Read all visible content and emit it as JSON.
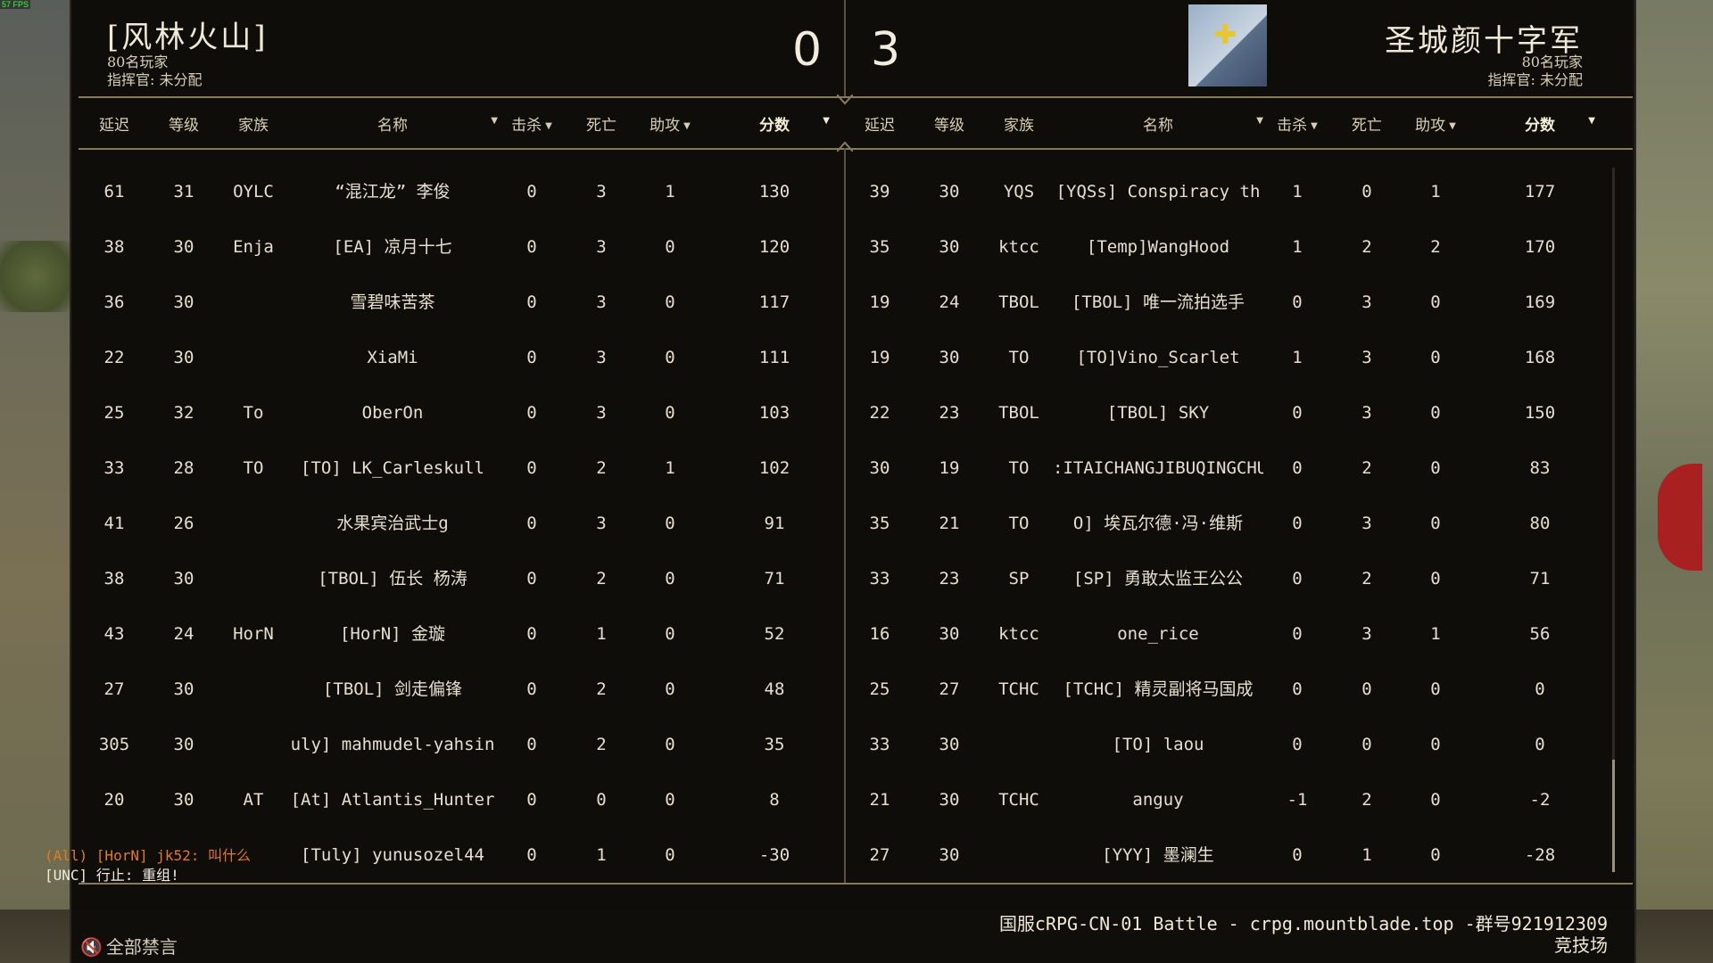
{
  "fps": "57 FPS",
  "left_team": {
    "name": "[风林火山]",
    "players": "80名玩家",
    "commander": "指挥官: 未分配",
    "score": "0"
  },
  "right_team": {
    "name": "圣城颜十字军",
    "players": "80名玩家",
    "commander": "指挥官: 未分配",
    "score": "3",
    "banner_icon": "cross-icon",
    "banner_colors": [
      "#c8d4e0",
      "#3e4e6a",
      "#e8c72a"
    ]
  },
  "columns": {
    "ping": "延迟",
    "level": "等级",
    "clan": "家族",
    "name": "名称",
    "kills": "击杀",
    "deaths": "死亡",
    "assists": "助攻",
    "score": "分数"
  },
  "left_rows": [
    {
      "ping": "61",
      "level": "31",
      "clan": "OYLC",
      "name": "“混江龙” 李俊",
      "kills": "0",
      "deaths": "3",
      "assists": "1",
      "score": "130"
    },
    {
      "ping": "38",
      "level": "30",
      "clan": "Enja",
      "name": "[EA] 凉月十七",
      "kills": "0",
      "deaths": "3",
      "assists": "0",
      "score": "120"
    },
    {
      "ping": "36",
      "level": "30",
      "clan": "",
      "name": "雪碧味苦茶",
      "kills": "0",
      "deaths": "3",
      "assists": "0",
      "score": "117"
    },
    {
      "ping": "22",
      "level": "30",
      "clan": "",
      "name": "XiaMi",
      "kills": "0",
      "deaths": "3",
      "assists": "0",
      "score": "111"
    },
    {
      "ping": "25",
      "level": "32",
      "clan": "To",
      "name": "OberOn",
      "kills": "0",
      "deaths": "3",
      "assists": "0",
      "score": "103"
    },
    {
      "ping": "33",
      "level": "28",
      "clan": "TO",
      "name": "[TO] LK_Carleskull",
      "kills": "0",
      "deaths": "2",
      "assists": "1",
      "score": "102"
    },
    {
      "ping": "41",
      "level": "26",
      "clan": "",
      "name": "水果宾治武士g",
      "kills": "0",
      "deaths": "3",
      "assists": "0",
      "score": "91"
    },
    {
      "ping": "38",
      "level": "30",
      "clan": "",
      "name": "[TBOL] 伍长 杨涛",
      "kills": "0",
      "deaths": "2",
      "assists": "0",
      "score": "71"
    },
    {
      "ping": "43",
      "level": "24",
      "clan": "HorN",
      "name": "[HorN] 金璇",
      "kills": "0",
      "deaths": "1",
      "assists": "0",
      "score": "52"
    },
    {
      "ping": "27",
      "level": "30",
      "clan": "",
      "name": "[TBOL] 剑走偏锋",
      "kills": "0",
      "deaths": "2",
      "assists": "0",
      "score": "48"
    },
    {
      "ping": "305",
      "level": "30",
      "clan": "",
      "name": "uly] mahmudel-yahsin",
      "kills": "0",
      "deaths": "2",
      "assists": "0",
      "score": "35"
    },
    {
      "ping": "20",
      "level": "30",
      "clan": "AT",
      "name": "[At] Atlantis_Hunter",
      "kills": "0",
      "deaths": "0",
      "assists": "0",
      "score": "8"
    },
    {
      "ping": "",
      "level": "",
      "clan": "",
      "name": "[Tuly] yunusozel44",
      "kills": "0",
      "deaths": "1",
      "assists": "0",
      "score": "-30"
    }
  ],
  "right_rows": [
    {
      "ping": "39",
      "level": "30",
      "clan": "YQS",
      "name": "[YQSs] Conspiracy th",
      "kills": "1",
      "deaths": "0",
      "assists": "1",
      "score": "177"
    },
    {
      "ping": "35",
      "level": "30",
      "clan": "ktcc",
      "name": "[Temp]WangHood",
      "kills": "1",
      "deaths": "2",
      "assists": "2",
      "score": "170"
    },
    {
      "ping": "19",
      "level": "24",
      "clan": "TBOL",
      "name": "[TBOL] 唯一流拍选手",
      "kills": "0",
      "deaths": "3",
      "assists": "0",
      "score": "169"
    },
    {
      "ping": "19",
      "level": "30",
      "clan": "TO",
      "name": "[TO]Vino_Scarlet",
      "kills": "1",
      "deaths": "3",
      "assists": "0",
      "score": "168"
    },
    {
      "ping": "22",
      "level": "23",
      "clan": "TBOL",
      "name": "[TBOL] SKY",
      "kills": "0",
      "deaths": "3",
      "assists": "0",
      "score": "150"
    },
    {
      "ping": "30",
      "level": "19",
      "clan": "TO",
      "name": ":ITAICHANGJIBUQINGCHU",
      "kills": "0",
      "deaths": "2",
      "assists": "0",
      "score": "83"
    },
    {
      "ping": "35",
      "level": "21",
      "clan": "TO",
      "name": "O] 埃瓦尔德·冯·维斯",
      "kills": "0",
      "deaths": "3",
      "assists": "0",
      "score": "80"
    },
    {
      "ping": "33",
      "level": "23",
      "clan": "SP",
      "name": "[SP] 勇敢太监王公公",
      "kills": "0",
      "deaths": "2",
      "assists": "0",
      "score": "71"
    },
    {
      "ping": "16",
      "level": "30",
      "clan": "ktcc",
      "name": "one_rice",
      "kills": "0",
      "deaths": "3",
      "assists": "1",
      "score": "56"
    },
    {
      "ping": "25",
      "level": "27",
      "clan": "TCHC",
      "name": "[TCHC] 精灵副将马国成",
      "kills": "0",
      "deaths": "0",
      "assists": "0",
      "score": "0"
    },
    {
      "ping": "33",
      "level": "30",
      "clan": "",
      "name": "[TO] laou",
      "kills": "0",
      "deaths": "0",
      "assists": "0",
      "score": "0"
    },
    {
      "ping": "21",
      "level": "30",
      "clan": "TCHC",
      "name": "anguy",
      "kills": "-1",
      "deaths": "2",
      "assists": "0",
      "score": "-2"
    },
    {
      "ping": "27",
      "level": "30",
      "clan": "",
      "name": "[YYY] 墨澜生",
      "kills": "0",
      "deaths": "1",
      "assists": "0",
      "score": "-28"
    }
  ],
  "chat": [
    "(All) [HorN] jk52: 叫什么",
    "[UNC] 行止: 重组!"
  ],
  "server_info": "国服cRPG-CN-01 Battle - crpg.mountblade.top -群号921912309",
  "game_mode": "竞技场",
  "mute_all_label": "全部禁言",
  "mute_icon": "speaker-muted-icon"
}
